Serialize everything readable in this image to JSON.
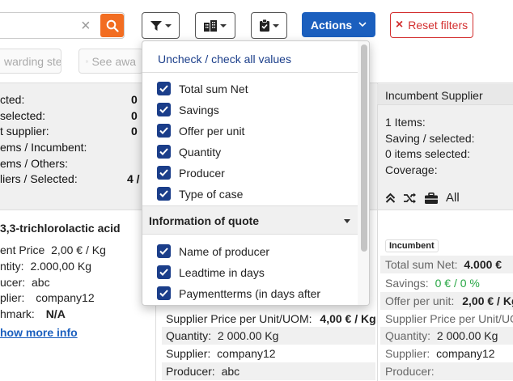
{
  "toolbar": {
    "search_clear": "×",
    "actions_label": "Actions",
    "reset_label": "Reset filters",
    "reset_icon": "×"
  },
  "row2": {
    "btn1_label": "warding step",
    "btn2_label": "See awa"
  },
  "summary": {
    "rows": [
      {
        "label": "cted:",
        "value": "0"
      },
      {
        "label": "selected:",
        "value": "0"
      },
      {
        "label": "t supplier:",
        "value": "0"
      },
      {
        "label": "ems / Incumbent:",
        "value": ""
      },
      {
        "label": "ems / Others:",
        "value": ""
      },
      {
        "label": "liers / Selected:",
        "value": "4 /"
      }
    ]
  },
  "incumbent": {
    "header": "Incumbent Supplier",
    "items": "1 Items:",
    "saving": "Saving / selected:",
    "items_selected": "0 items selected:",
    "coverage": "Coverage:",
    "all_label": "All",
    "badge": "Incumbent",
    "total_label": "Total sum Net:",
    "total_value": "4.000 €",
    "savings_label": "Savings:",
    "savings_value": "0 € / 0 %",
    "offer_label": "Offer per unit:",
    "offer_value": "2,00 € / Kg",
    "supplier_price_label": "Supplier Price per Unit/UOM:",
    "quantity_label": "Quantity:",
    "quantity_value": "2 000.00 Kg",
    "supplier_label": "Supplier:",
    "supplier_value": "company12",
    "producer_label": "Producer:"
  },
  "product": {
    "title": "3,3-trichlorolactic acid",
    "price_label": "ent Price",
    "price_value": "2,00 € / Kg",
    "quantity_label": "ntity:",
    "quantity_value": "2.000,00 Kg",
    "producer_label": "ucer:",
    "producer_value": "abc",
    "supplier_label": "plier:",
    "supplier_value": "company12",
    "benchmark_label": "hmark:",
    "benchmark_value": "N/A",
    "show_more": "how more info"
  },
  "middle": {
    "supplier_price_label": "Supplier Price per Unit/UOM:",
    "supplier_price_value": "4,00 € / Kg",
    "quantity_label": "Quantity:",
    "quantity_value": "2 000.00 Kg",
    "supplier_label": "Supplier:",
    "supplier_value": "company12",
    "producer_label": "Producer:",
    "producer_value": "abc"
  },
  "dropdown": {
    "uncheck_label": "Uncheck / check all values",
    "items": [
      "Total sum Net",
      "Savings",
      "Offer per unit",
      "Quantity",
      "Producer",
      "Type of case"
    ],
    "section_label": "Information of quote",
    "section_items": [
      "Name of producer",
      "Leadtime in days",
      "Paymentterms (in days after"
    ]
  },
  "colors": {
    "accent_blue": "#1b5fbe",
    "checkbox_blue": "#1b3e8a",
    "search_orange": "#f26d21",
    "reset_red": "#d32f2f",
    "savings_green": "#28a745"
  }
}
